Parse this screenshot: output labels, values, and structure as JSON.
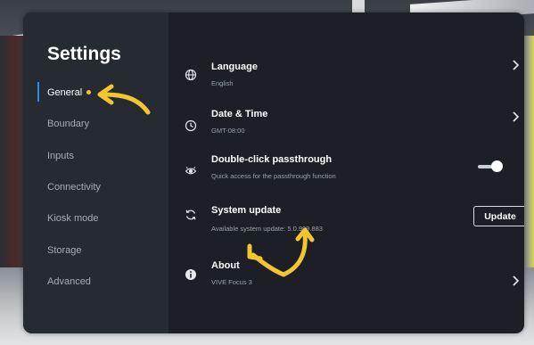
{
  "sidebar": {
    "title": "Settings",
    "items": [
      {
        "label": "General",
        "active": true
      },
      {
        "label": "Boundary"
      },
      {
        "label": "Inputs"
      },
      {
        "label": "Connectivity"
      },
      {
        "label": "Kiosk mode"
      },
      {
        "label": "Storage"
      },
      {
        "label": "Advanced"
      }
    ]
  },
  "settings": {
    "language": {
      "title": "Language",
      "value": "English",
      "icon": "globe-icon"
    },
    "datetime": {
      "title": "Date & Time",
      "value": "GMT-08:00",
      "icon": "clock-icon"
    },
    "passthrough": {
      "title": "Double-click passthrough",
      "description": "Quick access for the passthrough function",
      "icon": "passthrough-icon",
      "enabled": true
    },
    "update": {
      "title": "System update",
      "description": "Available system update: 5.0.999.883",
      "button_label": "Update",
      "icon": "sync-icon"
    },
    "about": {
      "title": "About",
      "value": "VIVE Focus 3",
      "icon": "info-icon"
    }
  },
  "colors": {
    "accent": "#2e8cf0",
    "annotation": "#f4c531",
    "panel": "#1f2329"
  }
}
